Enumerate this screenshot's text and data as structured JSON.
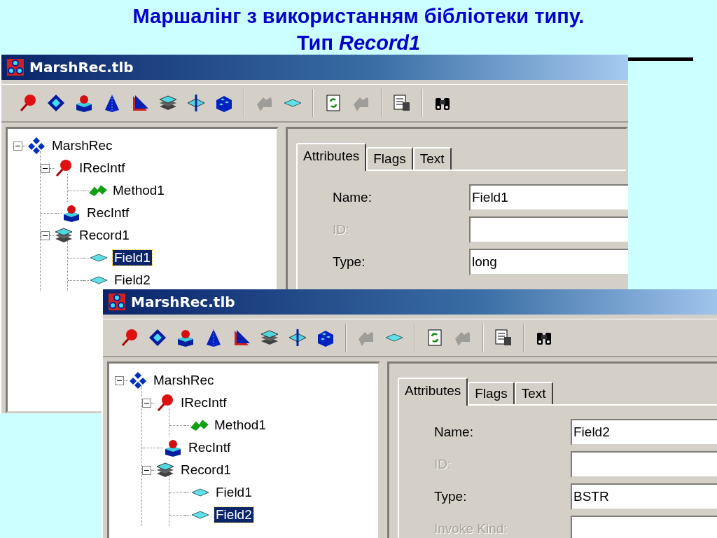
{
  "slide_title": {
    "line_1": "Маршалінг з використанням бібліотеки типу.",
    "line_2": "Тип *Record1*"
  },
  "windows": [
    {
      "title": "MarshRec.tlb",
      "toolbar": [
        [
          {
            "kind": "pin",
            "disabled": false
          },
          {
            "kind": "diamond",
            "disabled": false
          },
          {
            "kind": "box-ball",
            "disabled": false
          },
          {
            "kind": "cone",
            "disabled": false
          },
          {
            "kind": "wedge",
            "disabled": false
          },
          {
            "kind": "layers",
            "disabled": false
          },
          {
            "kind": "diamond-arrow",
            "disabled": false
          },
          {
            "kind": "cubes",
            "disabled": false
          }
        ],
        [
          {
            "kind": "arrow",
            "disabled": true
          },
          {
            "kind": "flat-diamond",
            "disabled": false
          }
        ],
        [
          {
            "kind": "refresh",
            "disabled": false
          },
          {
            "kind": "arrow",
            "disabled": true
          }
        ],
        [
          {
            "kind": "export",
            "disabled": false
          }
        ],
        [
          {
            "kind": "binoculars",
            "disabled": false
          }
        ]
      ],
      "tree": [
        {
          "label": "MarshRec",
          "kind": "library",
          "expanded": true,
          "selected": false,
          "children": [
            {
              "label": "IRecIntf",
              "kind": "pin",
              "expanded": true,
              "selected": false,
              "children": [
                {
                  "label": "Method1",
                  "kind": "method",
                  "selected": false
                }
              ]
            },
            {
              "label": "RecIntf",
              "kind": "box-ball",
              "selected": false
            },
            {
              "label": "Record1",
              "kind": "layers",
              "expanded": true,
              "selected": false,
              "children": [
                {
                  "label": "Field1",
                  "kind": "flat-diamond",
                  "selected": true
                },
                {
                  "label": "Field2",
                  "kind": "flat-diamond",
                  "selected": false
                }
              ]
            }
          ]
        }
      ],
      "tabs": [
        {
          "label": "Attributes",
          "selected": true
        },
        {
          "label": "Flags",
          "selected": false
        },
        {
          "label": "Text",
          "selected": false
        }
      ],
      "fields": [
        {
          "label": "Name:",
          "value": "Field1",
          "disabled": false
        },
        {
          "label": "ID:",
          "disabled": true
        },
        {
          "label": "Type:",
          "value": "long",
          "disabled": false
        }
      ]
    },
    {
      "title": "MarshRec.tlb",
      "toolbar": [
        [
          {
            "kind": "pin",
            "disabled": false
          },
          {
            "kind": "diamond",
            "disabled": false
          },
          {
            "kind": "box-ball",
            "disabled": false
          },
          {
            "kind": "cone",
            "disabled": false
          },
          {
            "kind": "wedge",
            "disabled": false
          },
          {
            "kind": "layers",
            "disabled": false
          },
          {
            "kind": "diamond-arrow",
            "disabled": false
          },
          {
            "kind": "cubes",
            "disabled": false
          }
        ],
        [
          {
            "kind": "arrow",
            "disabled": true
          },
          {
            "kind": "flat-diamond",
            "disabled": false
          }
        ],
        [
          {
            "kind": "refresh",
            "disabled": false
          },
          {
            "kind": "arrow",
            "disabled": true
          }
        ],
        [
          {
            "kind": "export",
            "disabled": false
          }
        ],
        [
          {
            "kind": "binoculars",
            "disabled": false
          }
        ]
      ],
      "tree": [
        {
          "label": "MarshRec",
          "kind": "library",
          "expanded": true,
          "selected": false,
          "children": [
            {
              "label": "IRecIntf",
              "kind": "pin",
              "expanded": true,
              "selected": false,
              "children": [
                {
                  "label": "Method1",
                  "kind": "method",
                  "selected": false
                }
              ]
            },
            {
              "label": "RecIntf",
              "kind": "box-ball",
              "selected": false
            },
            {
              "label": "Record1",
              "kind": "layers",
              "expanded": true,
              "selected": false,
              "children": [
                {
                  "label": "Field1",
                  "kind": "flat-diamond",
                  "selected": false
                },
                {
                  "label": "Field2",
                  "kind": "flat-diamond",
                  "selected": true
                }
              ]
            }
          ]
        }
      ],
      "tabs": [
        {
          "label": "Attributes",
          "selected": true
        },
        {
          "label": "Flags",
          "selected": false
        },
        {
          "label": "Text",
          "selected": false
        }
      ],
      "fields": [
        {
          "label": "Name:",
          "value": "Field2",
          "disabled": false
        },
        {
          "label": "ID:",
          "disabled": true
        },
        {
          "label": "Type:",
          "value": "BSTR",
          "disabled": false
        },
        {
          "label": "Invoke Kind:",
          "disabled": true
        }
      ]
    }
  ]
}
